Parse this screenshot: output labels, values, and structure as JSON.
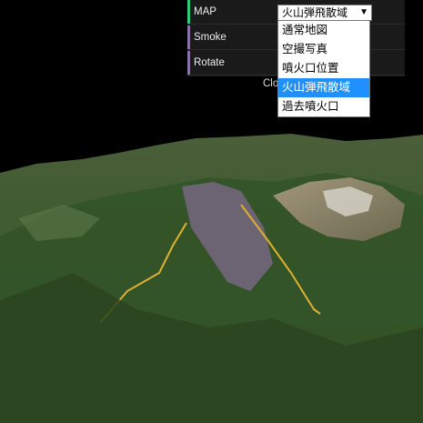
{
  "controls": {
    "map_label": "MAP",
    "smoke_label": "Smoke",
    "rotate_label": "Rotate",
    "map_selected": "火山弾飛散域",
    "map_options": [
      "通常地図",
      "空撮写真",
      "噴火口位置",
      "火山弾飛散域",
      "過去噴火口"
    ],
    "close_text": "Clo"
  },
  "colors": {
    "map_bar": "#2ecc71",
    "smoke_bar": "#8e6fa8",
    "rotate_bar": "#8e6fa8",
    "selected_option": "#1e90ff"
  }
}
